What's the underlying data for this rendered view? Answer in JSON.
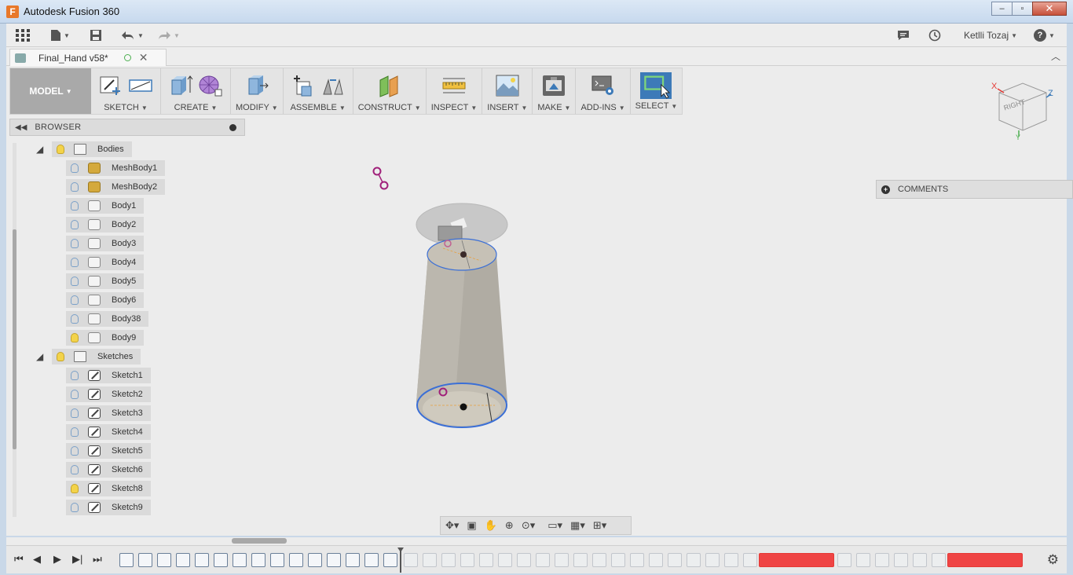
{
  "window": {
    "title": "Autodesk Fusion 360",
    "app_icon": "F",
    "minimize": "–",
    "maximize": "▫",
    "close": "✕"
  },
  "app_toolbar": {
    "user": "Ketlli Tozaj",
    "help": "?"
  },
  "tab": {
    "label": "Final_Hand v58*",
    "close": "✕"
  },
  "ribbon": {
    "workspace": "MODEL",
    "groups": [
      {
        "label": "SKETCH"
      },
      {
        "label": "CREATE"
      },
      {
        "label": "MODIFY"
      },
      {
        "label": "ASSEMBLE"
      },
      {
        "label": "CONSTRUCT"
      },
      {
        "label": "INSPECT"
      },
      {
        "label": "INSERT"
      },
      {
        "label": "MAKE"
      },
      {
        "label": "ADD-INS"
      },
      {
        "label": "SELECT"
      }
    ]
  },
  "browser": {
    "title": "BROWSER",
    "bodies_folder": "Bodies",
    "bodies": [
      {
        "name": "MeshBody1",
        "kind": "mesh",
        "visible": false
      },
      {
        "name": "MeshBody2",
        "kind": "mesh",
        "visible": false
      },
      {
        "name": "Body1",
        "kind": "body",
        "visible": false
      },
      {
        "name": "Body2",
        "kind": "body",
        "visible": false
      },
      {
        "name": "Body3",
        "kind": "body",
        "visible": false
      },
      {
        "name": "Body4",
        "kind": "body",
        "visible": false
      },
      {
        "name": "Body5",
        "kind": "body",
        "visible": false
      },
      {
        "name": "Body6",
        "kind": "body",
        "visible": false
      },
      {
        "name": "Body38",
        "kind": "body",
        "visible": false
      },
      {
        "name": "Body9",
        "kind": "body",
        "visible": true
      }
    ],
    "sketches_folder": "Sketches",
    "sketches": [
      {
        "name": "Sketch1",
        "visible": false
      },
      {
        "name": "Sketch2",
        "visible": false
      },
      {
        "name": "Sketch3",
        "visible": false
      },
      {
        "name": "Sketch4",
        "visible": false
      },
      {
        "name": "Sketch5",
        "visible": false
      },
      {
        "name": "Sketch6",
        "visible": false
      },
      {
        "name": "Sketch8",
        "visible": true
      },
      {
        "name": "Sketch9",
        "visible": false
      }
    ]
  },
  "viewcube": {
    "face": "RIGHT",
    "axis_x": "X",
    "axis_z": "Z",
    "axis_y": "Y"
  },
  "comments": {
    "label": "COMMENTS"
  },
  "colors": {
    "accent_blue": "#4a90d9",
    "select_active": "#3d7ab8",
    "error_red": "#ef4444",
    "model_gray": "#a9a9a9"
  }
}
